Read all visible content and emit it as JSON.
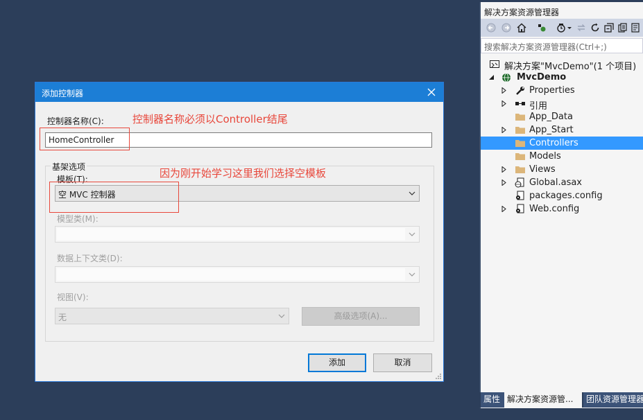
{
  "dialog": {
    "title": "添加控制器",
    "controller_name_label": "控制器名称(C):",
    "controller_name_value": "HomeController",
    "scaffold_group_label": "基架选项",
    "template_label": "模板(T):",
    "template_value": "空 MVC 控制器",
    "model_class_label": "模型类(M):",
    "data_context_label": "数据上下文类(D):",
    "view_label": "视图(V):",
    "view_value": "无",
    "advanced_button": "高级选项(A)...",
    "add_button": "添加",
    "cancel_button": "取消"
  },
  "annotations": {
    "note1": "控制器名称必须以Controller结尾",
    "note2": "因为刚开始学习这里我们选择空模板",
    "color": "#e8473b"
  },
  "solution_explorer": {
    "title": "解决方案资源管理器",
    "search_placeholder": "搜索解决方案资源管理器(Ctrl+;)",
    "items": [
      {
        "label": "解决方案\"MvcDemo\"(1 个项目)",
        "icon": "solution-icon",
        "expander": ""
      },
      {
        "label": "MvcDemo",
        "icon": "web-project-icon",
        "expander": "expanded"
      },
      {
        "label": "Properties",
        "icon": "wrench-icon",
        "expander": "collapsed"
      },
      {
        "label": "引用",
        "icon": "references-icon",
        "expander": "collapsed"
      },
      {
        "label": "App_Data",
        "icon": "folder-icon",
        "expander": ""
      },
      {
        "label": "App_Start",
        "icon": "folder-icon",
        "expander": "collapsed"
      },
      {
        "label": "Controllers",
        "icon": "folder-icon",
        "expander": "",
        "selected": true
      },
      {
        "label": "Models",
        "icon": "folder-icon",
        "expander": ""
      },
      {
        "label": "Views",
        "icon": "folder-icon",
        "expander": "collapsed"
      },
      {
        "label": "Global.asax",
        "icon": "global-asax-icon",
        "expander": "collapsed"
      },
      {
        "label": "packages.config",
        "icon": "config-file-icon",
        "expander": ""
      },
      {
        "label": "Web.config",
        "icon": "config-file-icon",
        "expander": "collapsed"
      }
    ],
    "tabs": [
      "属性",
      "解决方案资源管...",
      "团队资源管理器"
    ],
    "selection_color": "#3399ff"
  }
}
